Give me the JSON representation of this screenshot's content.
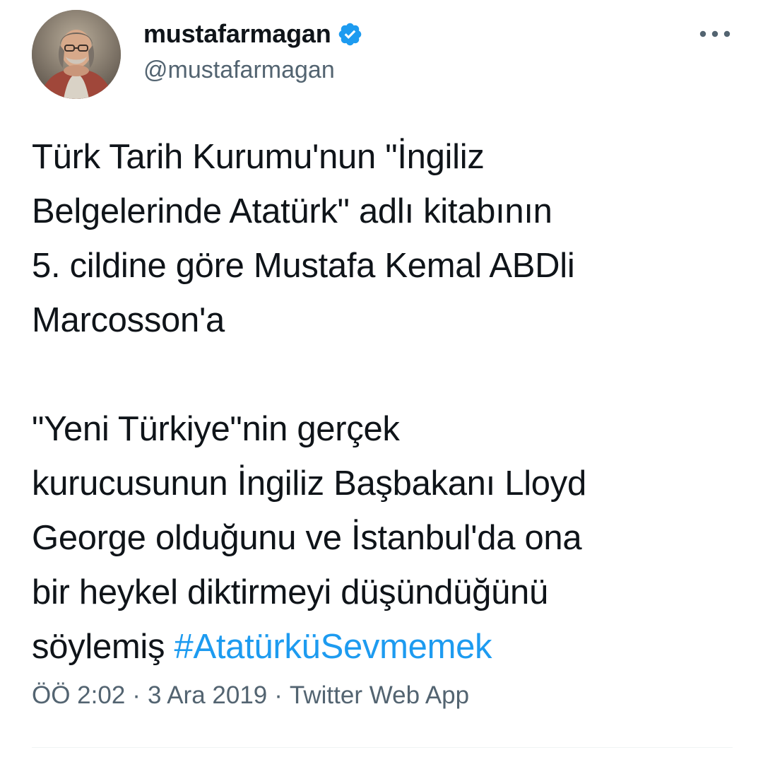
{
  "author": {
    "display_name": "mustafarmagan",
    "handle": "@mustafarmagan",
    "verified": true,
    "avatar_icon": "profile-photo",
    "verified_icon": "verified-badge-icon",
    "verified_color": "#1d9bf0"
  },
  "more_icon": "more-options-icon",
  "tweet": {
    "lines_p1": [
      "Türk Tarih Kurumu'nun \"İngiliz",
      "Belgelerinde Atatürk\" adlı kitabının",
      "5. cildine göre Mustafa Kemal ABDli",
      "Marcosson'a"
    ],
    "lines_p2": [
      "\"Yeni Türkiye\"nin gerçek",
      "kurucusunun İngiliz Başbakanı Lloyd",
      "George olduğunu ve İstanbul'da ona",
      "bir heykel diktirmeyi düşündüğünü"
    ],
    "last_line_text": "söylemiş",
    "hashtag": "#AtatürküSevmemek",
    "hashtag_color": "#1d9bf0"
  },
  "meta": {
    "time": "ÖÖ 2:02",
    "separator": "·",
    "date": "3 Ara 2019",
    "source": "Twitter Web App"
  }
}
